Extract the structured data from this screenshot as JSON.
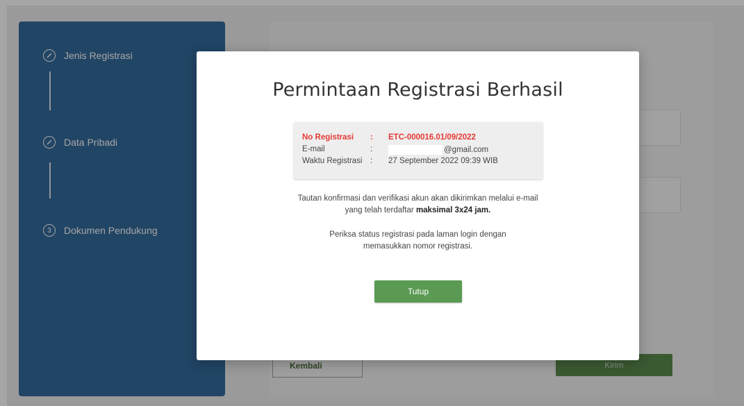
{
  "sidebar": {
    "steps": [
      {
        "label": "Jenis Registrasi",
        "icon": "pencil-icon"
      },
      {
        "label": "Data Pribadi",
        "icon": "pencil-icon"
      },
      {
        "label": "Dokumen Pendukung",
        "icon": "number-3-icon",
        "number": "3"
      }
    ]
  },
  "form": {
    "back_label": "Kembali",
    "send_label": "Kirim"
  },
  "modal": {
    "title": "Permintaan Registrasi Berhasil",
    "info": {
      "reg_label": "No Registrasi",
      "reg_value": "ETC-000016.01/09/2022",
      "email_label": "E-mail",
      "email_value": "@gmail.com",
      "time_label": "Waktu Registrasi",
      "time_value": "27 September 2022 09:39 WIB",
      "colon": ":"
    },
    "message1_line1": "Tautan konfirmasi dan verifikasi akun akan dikirimkan melalui e-mail",
    "message1_line2_pre": "yang telah terdaftar ",
    "message1_line2_bold": "maksimal 3x24 jam.",
    "message2_line1": "Periksa status registrasi pada laman login dengan",
    "message2_line2": "memasukkan nomor registrasi.",
    "close_label": "Tutup"
  },
  "colors": {
    "sidebar": "#336a9b",
    "accent_green": "#5a9a52",
    "alert_red": "#e53935"
  }
}
